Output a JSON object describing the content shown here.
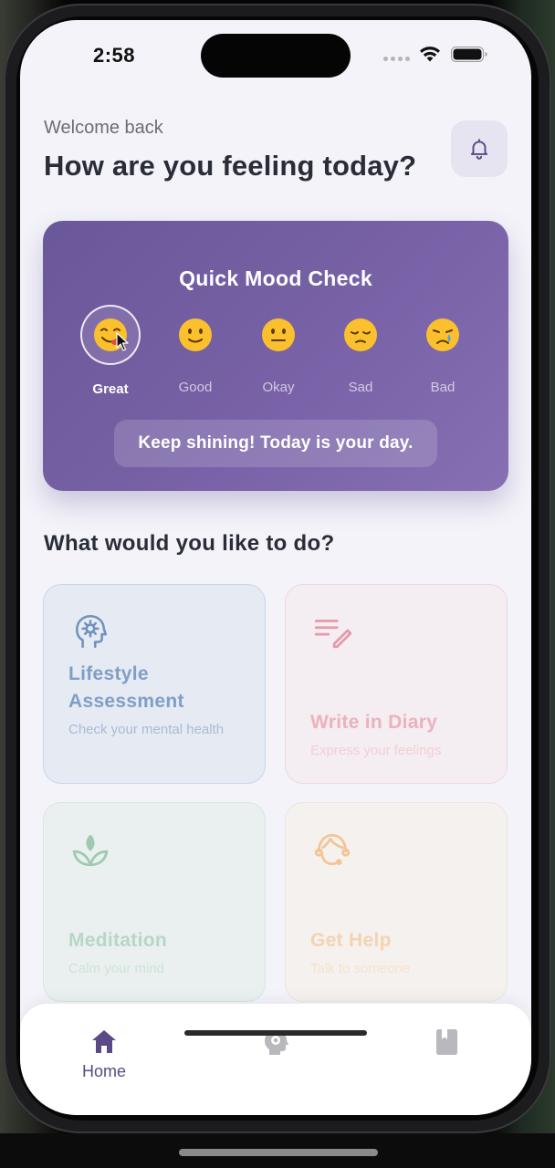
{
  "status_bar": {
    "time": "2:58"
  },
  "header": {
    "welcome": "Welcome back",
    "headline": "How are you feeling today?",
    "bell_icon": "bell-icon"
  },
  "mood_check": {
    "title": "Quick Mood Check",
    "options": [
      {
        "label": "Great",
        "emoji": "😋",
        "selected": true
      },
      {
        "label": "Good",
        "emoji": "🙂",
        "selected": false
      },
      {
        "label": "Okay",
        "emoji": "😐",
        "selected": false
      },
      {
        "label": "Sad",
        "emoji": "😔",
        "selected": false
      },
      {
        "label": "Bad",
        "emoji": "😢",
        "selected": false
      }
    ],
    "message": "Keep shining! Today is your day."
  },
  "actions": {
    "section_title": "What would you like to do?",
    "cards": [
      {
        "title": "Lifestyle Assessment",
        "description": "Check your mental health",
        "icon": "head-gear-icon",
        "color": "#7f9fc6"
      },
      {
        "title": "Write in Diary",
        "description": "Express your feelings",
        "icon": "write-icon",
        "color": "#ecb1bd"
      },
      {
        "title": "Meditation",
        "description": "Calm your mind",
        "icon": "lotus-icon",
        "color": "#b7d6c5"
      },
      {
        "title": "Get Help",
        "description": "Talk to someone",
        "icon": "headset-icon",
        "color": "#f4d3b1"
      }
    ]
  },
  "bottom_nav": {
    "items": [
      {
        "label": "Home",
        "icon": "home-icon",
        "active": true
      },
      {
        "label": "",
        "icon": "assessment-icon",
        "active": false
      },
      {
        "label": "",
        "icon": "diary-icon",
        "active": false
      }
    ]
  },
  "colors": {
    "accent": "#6a5799",
    "background": "#f3f3f9",
    "nav_active": "#5a4a86",
    "nav_inactive": "#b8b8bd"
  }
}
